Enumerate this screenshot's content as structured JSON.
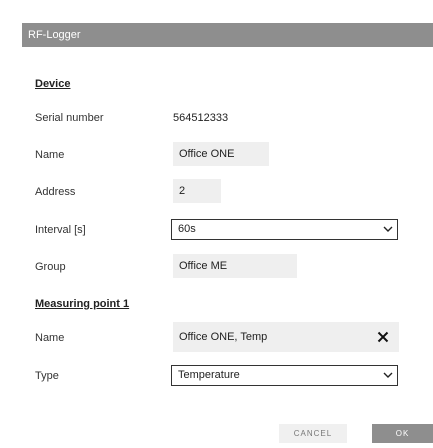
{
  "dialog": {
    "title": "RF-Logger"
  },
  "device": {
    "heading": "Device",
    "serial_label": "Serial number",
    "serial_value": "564512333",
    "name_label": "Name",
    "name_value": "Office ONE",
    "address_label": "Address",
    "address_value": "2",
    "interval_label": "Interval [s]",
    "interval_value": "60s",
    "group_label": "Group",
    "group_value": "Office ME"
  },
  "measuring_point": {
    "heading": "Measuring point 1",
    "name_label": "Name",
    "name_value": "Office ONE, Temp",
    "type_label": "Type",
    "type_value": "Temperature"
  },
  "buttons": {
    "cancel": "CANCEL",
    "ok": "OK"
  },
  "icons": {
    "chevron": "chevron-down-icon",
    "clear": "close-icon"
  },
  "colors": {
    "titlebar": "#8e8e8e",
    "field_bg": "#efefef",
    "ok_button": "#8e8e8e"
  }
}
